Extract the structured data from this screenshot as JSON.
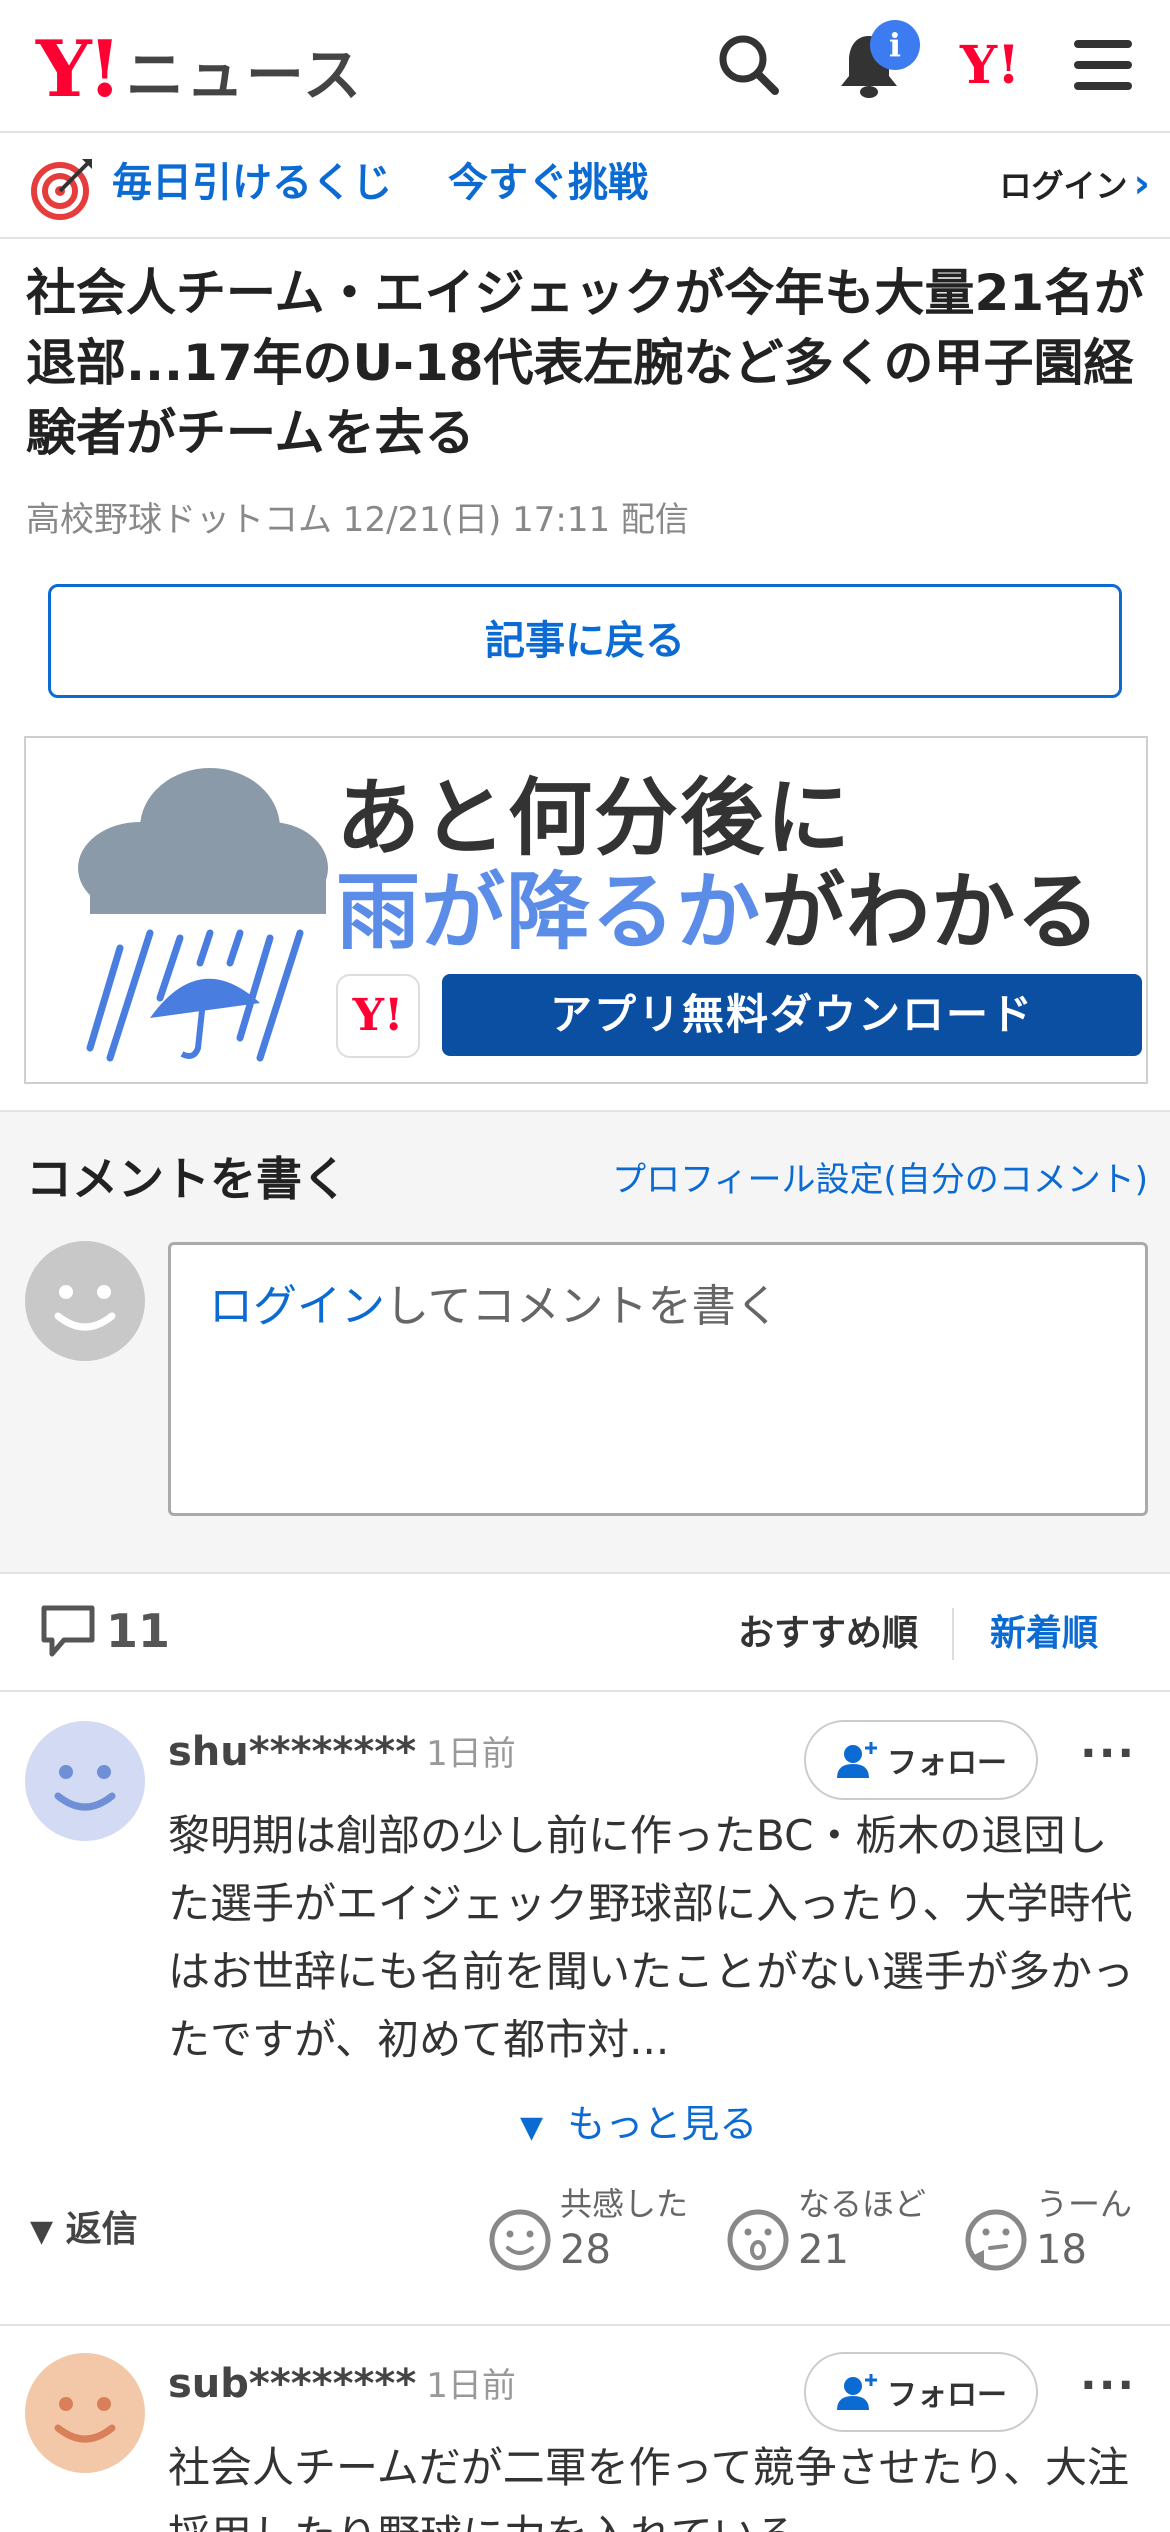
{
  "header": {
    "logo_mark": "Y!",
    "logo_text": "ニュース",
    "notification_count": "i",
    "yahoo_mark": "Y!"
  },
  "lottery": {
    "text1": "毎日引けるくじ",
    "text2": "今すぐ挑戦",
    "login": "ログイン"
  },
  "article": {
    "title": "社会人チーム・エイジェックが今年も大量21名が退部...17年のU-18代表左腕など多くの甲子園経験者がチームを去る",
    "meta": "高校野球ドットコム 12/21(日) 17:11 配信",
    "back_button": "記事に戻る"
  },
  "ad": {
    "line1": "あと何分後に",
    "line2_blue": "雨が降るか",
    "line2_dark": "がわかる",
    "app_mark": "Y!",
    "download": "アプリ無料ダウンロード"
  },
  "write": {
    "title": "コメントを書く",
    "profile_link": "プロフィール設定(自分のコメント)",
    "placeholder_link": "ログイン",
    "placeholder_rest": "してコメントを書く"
  },
  "sort": {
    "count": "11",
    "recommended": "おすすめ順",
    "newest": "新着順"
  },
  "comments": [
    {
      "user": "shu********",
      "time": "1日前",
      "follow": "フォロー",
      "body": "黎明期は創部の少し前に作ったBC・栃木の退団した選手がエイジェック野球部に入ったり、大学時代はお世辞にも名前を聞いたことがない選手が多かったですが、初めて都市対...",
      "see_more": "もっと見る",
      "reply": "返信",
      "reactions": [
        {
          "label": "共感した",
          "count": "28"
        },
        {
          "label": "なるほど",
          "count": "21"
        },
        {
          "label": "うーん",
          "count": "18"
        }
      ]
    },
    {
      "user": "sub********",
      "time": "1日前",
      "follow": "フォロー",
      "body": "社会人チームだが二軍を作って競争させたり、大注採用したり野球に力を入れている"
    }
  ],
  "colors": {
    "brand_red": "#ff0033",
    "link_blue": "#0b6bd3",
    "ad_blue": "#0b4fa3"
  }
}
